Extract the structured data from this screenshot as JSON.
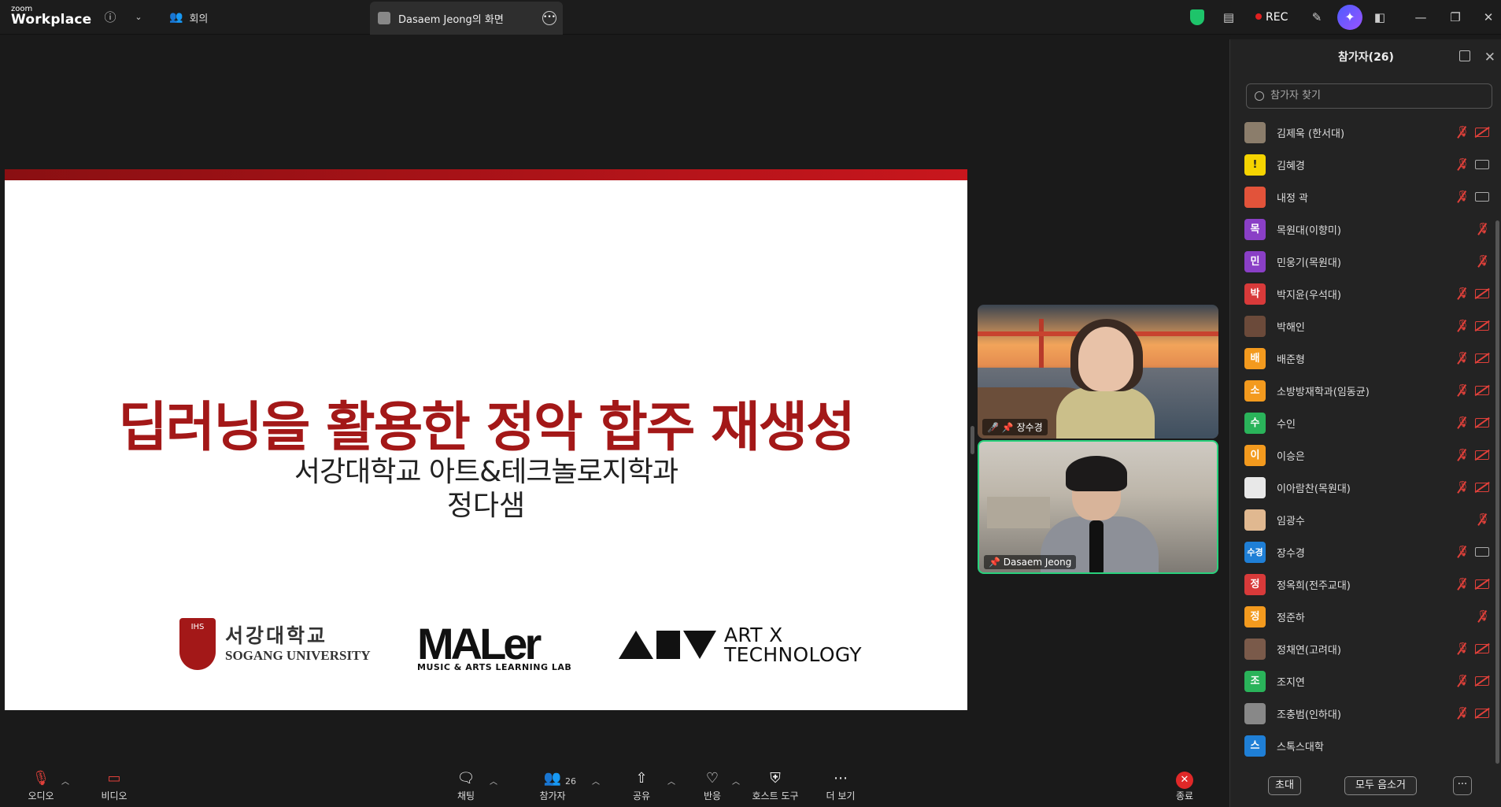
{
  "app": {
    "logo_small": "zoom",
    "logo_big": "Workplace"
  },
  "titlebar": {
    "meeting_tab": "회의",
    "share_tab": "Dasaem Jeong의 화면",
    "rec_label": "REC",
    "icons": [
      "info-icon",
      "chevron-down-icon",
      "shield-icon",
      "notes-icon",
      "pen-icon",
      "ai-companion-icon",
      "apps-icon",
      "minimize-icon",
      "restore-icon",
      "close-icon"
    ]
  },
  "slide": {
    "title": "딥러닝을 활용한 정악 합주 재생성",
    "subtitle": "서강대학교 아트&테크놀로지학과",
    "presenter": "정다샘",
    "logo1_ko": "서강대학교",
    "logo1_en": "SOGANG UNIVERSITY",
    "logo1_seal": "IHS",
    "logo2_big": "MALer",
    "logo2_small": "MUSIC & ARTS LEARNING LAB",
    "logo3_line1": "ART X",
    "logo3_line2": "TECHNOLOGY",
    "accent": "#a31818"
  },
  "videos": [
    {
      "name": "장수경",
      "muted": true,
      "pinned": true
    },
    {
      "name": "Dasaem Jeong",
      "muted": false,
      "pinned": true,
      "active_speaker": true
    }
  ],
  "panel": {
    "title": "참가자(26)",
    "search_placeholder": "참가자 찾기",
    "invite_label": "초대",
    "mute_all_label": "모두 음소거",
    "more_label": "···"
  },
  "participants": [
    {
      "name": "김제욱 (한서대)",
      "avatar": "",
      "color": "#8b7d6b",
      "mic": "off",
      "cam": "off"
    },
    {
      "name": "김혜경",
      "avatar": "!",
      "color": "#f5d400",
      "mic": "off",
      "cam": "on"
    },
    {
      "name": "내정 곽",
      "avatar": "",
      "color": "#e2533a",
      "mic": "off",
      "cam": "on"
    },
    {
      "name": "목원대(이향미)",
      "avatar": "목",
      "color": "#8a3fc6",
      "mic": "off",
      "cam": "none"
    },
    {
      "name": "민웅기(목원대)",
      "avatar": "민",
      "color": "#8a3fc6",
      "mic": "off",
      "cam": "none"
    },
    {
      "name": "박지윤(우석대)",
      "avatar": "박",
      "color": "#d83a3a",
      "mic": "off",
      "cam": "off"
    },
    {
      "name": "박해인",
      "avatar": "",
      "color": "#6b4a3a",
      "mic": "off",
      "cam": "off"
    },
    {
      "name": "배준형",
      "avatar": "배",
      "color": "#f39a1e",
      "mic": "off",
      "cam": "off"
    },
    {
      "name": "소방방재학과(임동균)",
      "avatar": "소",
      "color": "#f39a1e",
      "mic": "off",
      "cam": "off"
    },
    {
      "name": "수인",
      "avatar": "수",
      "color": "#2ab35a",
      "mic": "off",
      "cam": "off"
    },
    {
      "name": "이승은",
      "avatar": "이",
      "color": "#f39a1e",
      "mic": "off",
      "cam": "off"
    },
    {
      "name": "이아람찬(목원대)",
      "avatar": "",
      "color": "#e8e8e8",
      "mic": "off",
      "cam": "off"
    },
    {
      "name": "임광수",
      "avatar": "",
      "color": "#e0b890",
      "mic": "off",
      "cam": "none"
    },
    {
      "name": "장수경",
      "avatar": "수경",
      "color": "#1f7fd6",
      "mic": "off",
      "cam": "on"
    },
    {
      "name": "정옥희(전주교대)",
      "avatar": "정",
      "color": "#d83a3a",
      "mic": "off",
      "cam": "off"
    },
    {
      "name": "정준하",
      "avatar": "정",
      "color": "#f39a1e",
      "mic": "off",
      "cam": "none"
    },
    {
      "name": "정채연(고려대)",
      "avatar": "",
      "color": "#7a5a4a",
      "mic": "off",
      "cam": "off"
    },
    {
      "name": "조지연",
      "avatar": "조",
      "color": "#2ab35a",
      "mic": "off",
      "cam": "off"
    },
    {
      "name": "조충범(인하대)",
      "avatar": "",
      "color": "#888888",
      "mic": "off",
      "cam": "off"
    },
    {
      "name": "스톡스대학",
      "avatar": "스",
      "color": "#1f7fd6",
      "mic": "none",
      "cam": "none"
    }
  ],
  "toolbar": {
    "audio": "오디오",
    "video": "비디오",
    "chat": "채팅",
    "participants": "참가자",
    "participants_count": "26",
    "share": "공유",
    "react": "반응",
    "host_tools": "호스트 도구",
    "more": "더 보기",
    "end": "종료"
  }
}
